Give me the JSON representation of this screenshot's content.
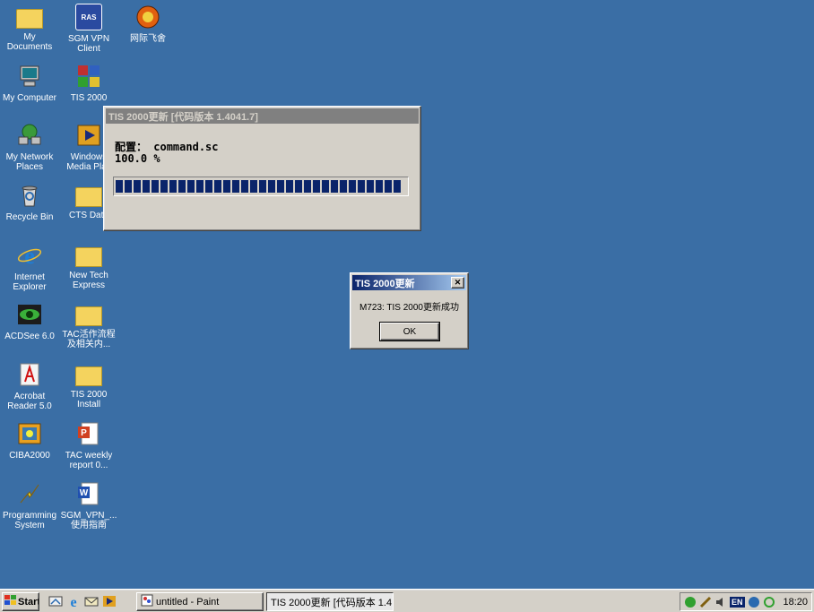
{
  "desktop": {
    "icons": [
      {
        "label": "My Documents"
      },
      {
        "label": "SGM VPN\nClient",
        "badge": "RAS"
      },
      {
        "label": "网际飞舍"
      },
      {
        "label": "My Computer"
      },
      {
        "label": "TIS 2000"
      },
      {
        "label": "My Network\nPlaces"
      },
      {
        "label": "Windows\nMedia Play"
      },
      {
        "label": "Recycle Bin"
      },
      {
        "label": "CTS Data"
      },
      {
        "label": "Internet\nExplorer"
      },
      {
        "label": "New Tech\nExpress"
      },
      {
        "label": "ACDSee 6.0"
      },
      {
        "label": "TAC活作流程\n及相关内..."
      },
      {
        "label": "Acrobat\nReader 5.0"
      },
      {
        "label": "TIS 2000\nInstall"
      },
      {
        "label": "CIBA2000"
      },
      {
        "label": "TAC weekly\nreport 0..."
      },
      {
        "label": "Programming\nSystem"
      },
      {
        "label": "SGM_VPN_...\n使用指南"
      }
    ]
  },
  "update_window": {
    "title": "TIS 2000更新 [代码版本 1.4041.7]",
    "config_label": "配置：",
    "config_value": "command.sc",
    "percent": "100.0 %",
    "progress": 1.0
  },
  "dialog": {
    "title": "TIS 2000更新",
    "close_glyph": "✕",
    "message": "M723: TIS 2000更新成功",
    "ok_label": "OK"
  },
  "taskbar": {
    "start_label": "Start",
    "tasks": [
      {
        "label": "untitled - Paint"
      },
      {
        "label": "TIS 2000更新 [代码版本 1.4..."
      }
    ],
    "tray_lang": "EN",
    "clock": "18:20"
  },
  "colors": {
    "desktop": "#3a6ea5",
    "title_active": "#0a246a",
    "title_inactive": "#808080",
    "progress": "#0a246a"
  }
}
